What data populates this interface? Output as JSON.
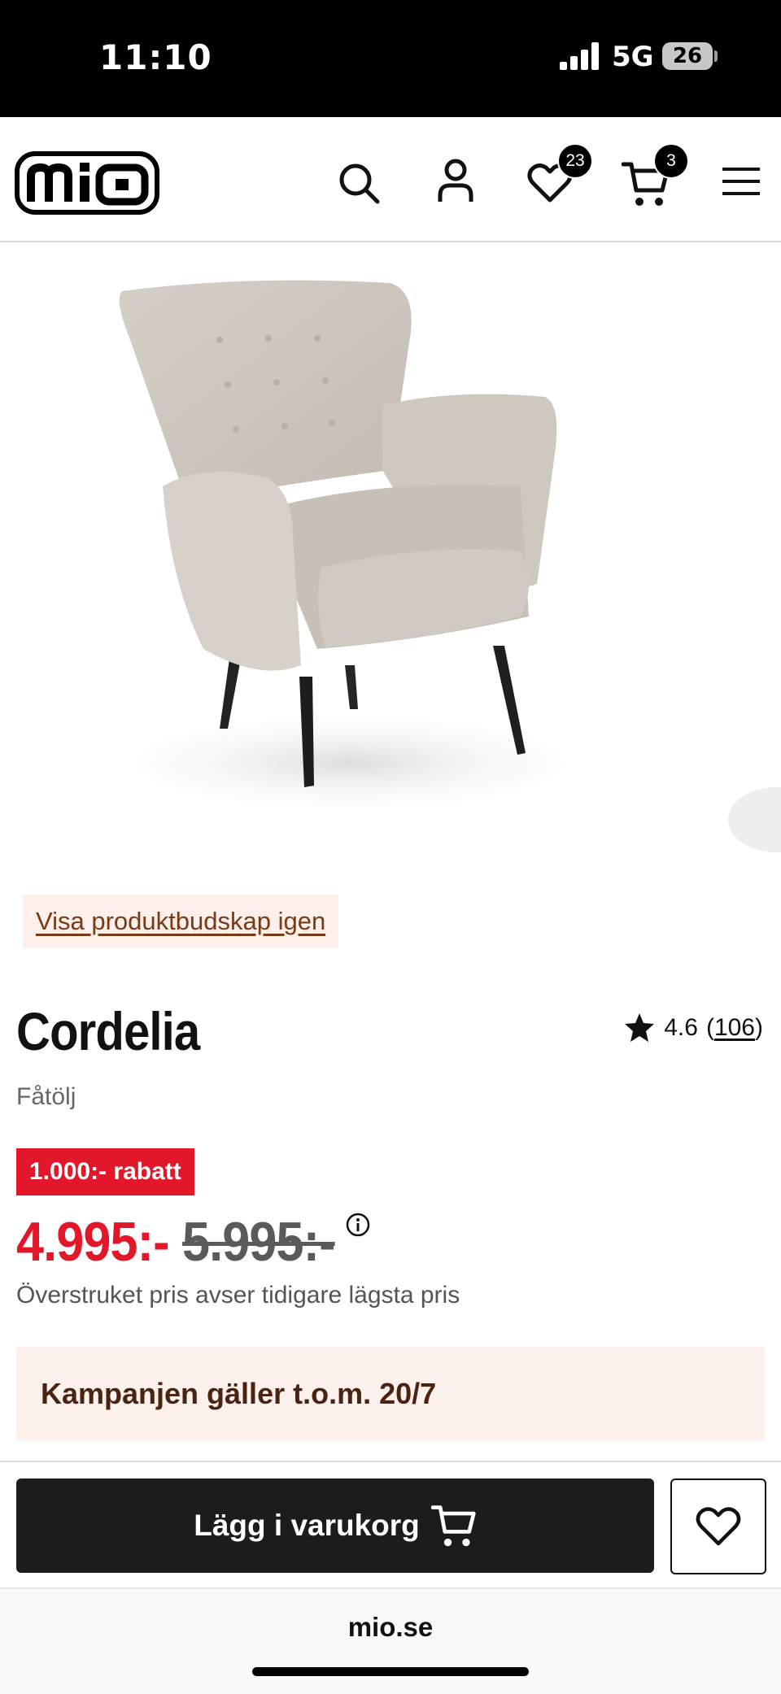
{
  "status_bar": {
    "time": "11:10",
    "network": "5G",
    "battery": "26"
  },
  "header": {
    "logo_text": "mio",
    "wishlist_count": "23",
    "cart_count": "3"
  },
  "product": {
    "message_link": "Visa produktbudskap igen",
    "name": "Cordelia",
    "category": "Fåtölj",
    "rating": {
      "score": "4.6",
      "open_paren": "(",
      "reviews": "106",
      "close_paren": ")"
    },
    "discount_label": "1.000:- rabatt",
    "price_now": "4.995:-",
    "price_was": "5.995:-",
    "price_note": "Överstruket pris avser tidigare lägsta pris",
    "campaign_text": "Kampanjen gäller t.o.m. 20/7"
  },
  "actions": {
    "add_to_cart_label": "Lägg i varukorg"
  },
  "browser": {
    "url": "mio.se"
  },
  "colors": {
    "accent_red": "#e3172a",
    "dark": "#1c1c1c",
    "campaign_bg": "#fdf1ee"
  }
}
